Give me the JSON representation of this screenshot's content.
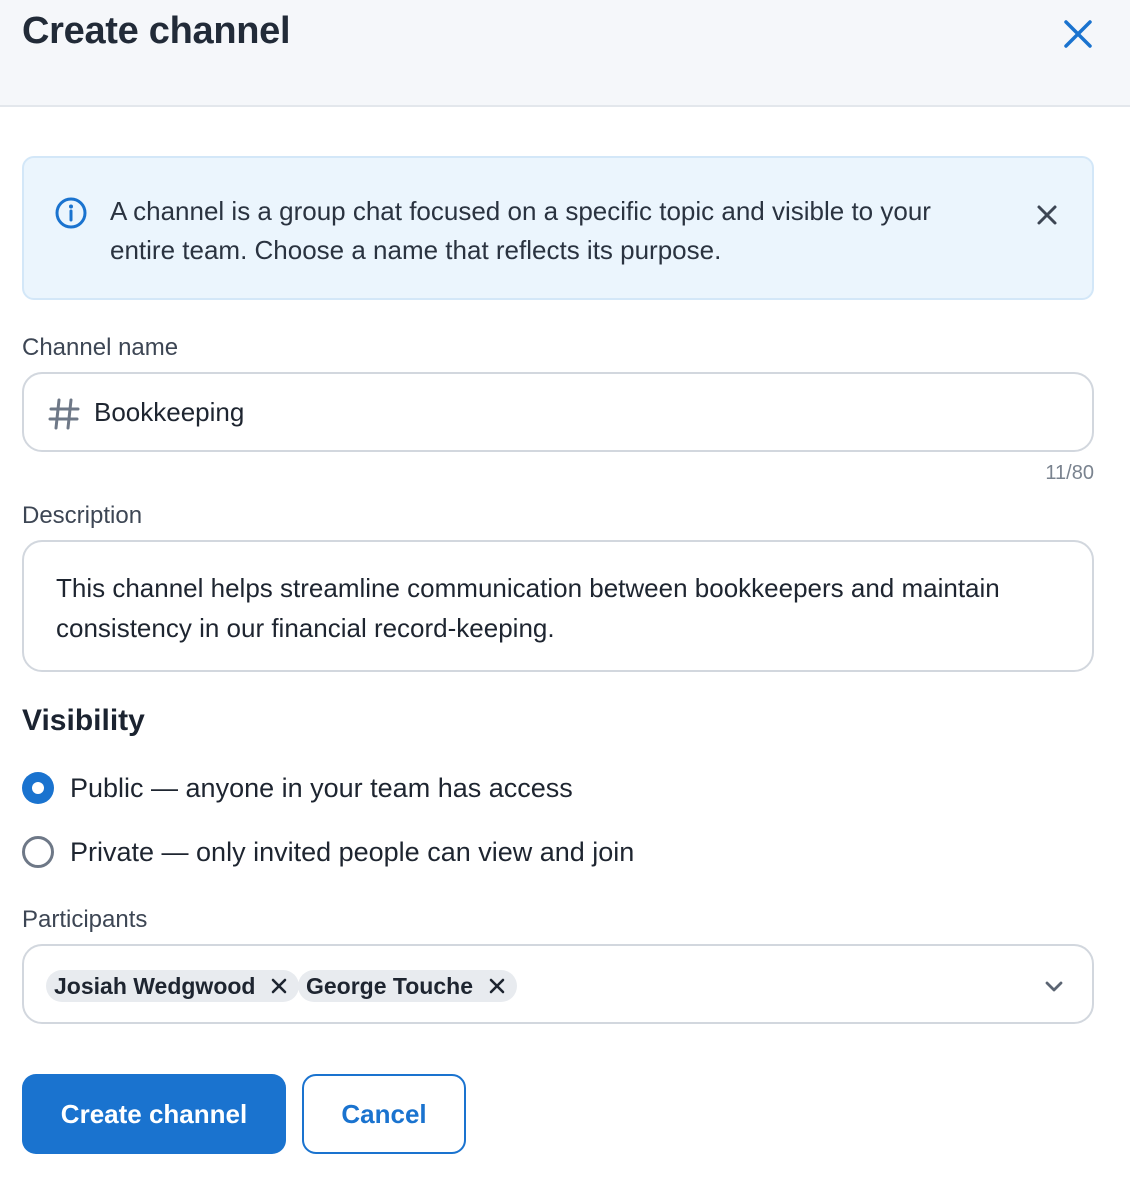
{
  "dialog": {
    "title": "Create channel",
    "close_icon": "close-icon"
  },
  "banner": {
    "icon": "info-icon",
    "text": "A channel is a group chat focused on a specific topic and visible to your entire team. Choose a name that reflects its purpose.",
    "dismiss_icon": "close-icon"
  },
  "channel_name": {
    "label": "Channel name",
    "prefix_icon": "hash-icon",
    "value": "Bookkeeping",
    "counter": "11/80"
  },
  "description": {
    "label": "Description",
    "value": "This channel helps streamline communication between bookkeepers and maintain consistency in our financial record-keeping."
  },
  "visibility": {
    "title": "Visibility",
    "options": [
      {
        "label": "Public — anyone in your team has access",
        "selected": true
      },
      {
        "label": "Private — only invited people can view and join",
        "selected": false
      }
    ]
  },
  "participants": {
    "label": "Participants",
    "chips": [
      {
        "name": "Josiah Wedgwood"
      },
      {
        "name": "George Touche"
      }
    ],
    "dropdown_icon": "chevron-down-icon"
  },
  "actions": {
    "create_label": "Create channel",
    "cancel_label": "Cancel"
  },
  "colors": {
    "accent": "#1a73cf",
    "banner_bg": "#ebf5fd",
    "header_bg": "#f5f7fa"
  }
}
